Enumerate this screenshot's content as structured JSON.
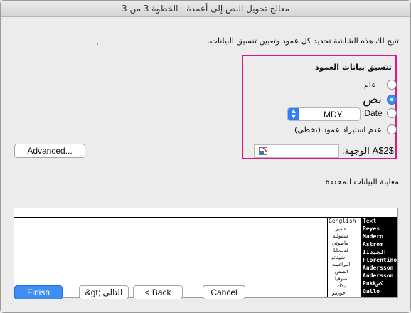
{
  "window": {
    "title": "معالج تحويل النص إلى أعمدة - الخطوة 3 من 3"
  },
  "instructions": "تتيح لك هذه الشاشة تحديد كل عمود وتعيين تنسيق البيانات.",
  "column_format": {
    "title": "تنسيق بيانات العمود",
    "options": [
      {
        "label": "عام",
        "checked": false
      },
      {
        "label": "نص",
        "checked": true
      },
      {
        "label": "Date:",
        "checked": false
      },
      {
        "label": "عدم استيراد عمود (تخطي)",
        "checked": false
      }
    ],
    "date_value": "MDY"
  },
  "advanced_label": "Advanced...",
  "destination": {
    "label": "الوجهة:",
    "value": "$A$2"
  },
  "preview": {
    "label": "معاينة البيانات المحددة",
    "headers": [
      "Text",
      "Genglish"
    ],
    "text_col": [
      "Reyes",
      "Madero",
      "Astrom",
      "IIالجيد",
      "Florentino",
      "Andersson",
      "Andersson",
      "Pukkكس",
      "Gallo"
    ],
    "second_col": [
      "عنفير",
      "شمولية",
      "ماطوتي",
      "قدتLL",
      "شوتاتو",
      "البراعيت",
      "الصص",
      "صوفيا",
      "بلاك",
      "جوزمو"
    ]
  },
  "buttons": {
    "cancel": "Cancel",
    "back": "< Back",
    "next": "&gt; التالي",
    "finish": "Finish"
  },
  "colors": {
    "accent": "#3d8df5",
    "highlight": "#e4148b"
  }
}
